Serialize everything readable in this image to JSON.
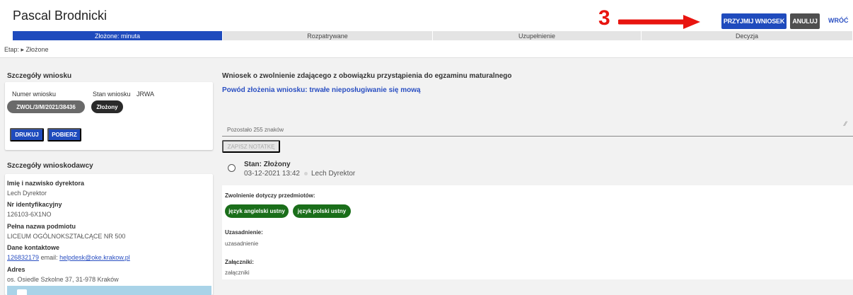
{
  "header": {
    "title": "Pascal Brodnicki",
    "annotation_number": "3",
    "accept_button": "PRZYJMIJ WNIOSEK",
    "cancel_button": "ANULUJ",
    "back_link": "WRÓĆ"
  },
  "stages": [
    {
      "label": "Złożone: minuta",
      "active": true
    },
    {
      "label": "Rozpatrywane",
      "active": false
    },
    {
      "label": "Uzupełnienie",
      "active": false
    },
    {
      "label": "Decyzja",
      "active": false
    }
  ],
  "breadcrumb": "Etap: ▸ Złożone",
  "application": {
    "section_title": "Szczegóły wniosku",
    "number_label": "Numer wniosku",
    "status_label": "Stan wniosku",
    "status_source": "JRWA",
    "number_value": "ZWOL/3/M/2021/38436",
    "status_value": "Złożony",
    "print_button": "DRUKUJ",
    "download_button": "POBIERZ"
  },
  "applicant": {
    "section_title": "Szczegóły wnioskodawcy",
    "director_label": "Imię i nazwisko dyrektora",
    "director_value": "Lech Dyrektor",
    "id_label": "Nr identyfikacyjny",
    "id_value": "126103-6X1NO",
    "entity_label": "Pełna nazwa podmiotu",
    "entity_value": "LICEUM OGÓLNOKSZTAŁCĄCE NR 500",
    "contact_label": "Dane kontaktowe",
    "phone": "126832179",
    "email_prefix": "email:",
    "email": "helpdesk@oke.krakow.pl",
    "address_label": "Adres",
    "address_value": "os. Osiedle Szkolne 37, 31-978 Kraków"
  },
  "main": {
    "title": "Wniosek o zwolnienie zdającego z obowiązku przystąpienia do egzaminu maturalnego",
    "reason": "Powód złożenia wniosku: trwałe nieposługiwanie się mową",
    "chars_left": "Pozostało 255 znaków",
    "save_note_button": "ZAPISZ NOTATKĘ",
    "status_title": "Stan: Złożony",
    "status_date": "03-12-2021 13:42",
    "status_user": "Lech Dyrektor",
    "subjects_label": "Zwolnienie dotyczy przedmiotów:",
    "subjects": [
      "język angielski ustny",
      "język polski ustny"
    ],
    "justification_label": "Uzasadnienie:",
    "justification_value": "uzasadnienie",
    "attachments_label": "Załączniki:",
    "attachments_value": "załączniki"
  },
  "colors": {
    "primary": "#1f4bbd",
    "annotation": "#e8140f",
    "subject_chip": "#1a6e1a"
  }
}
